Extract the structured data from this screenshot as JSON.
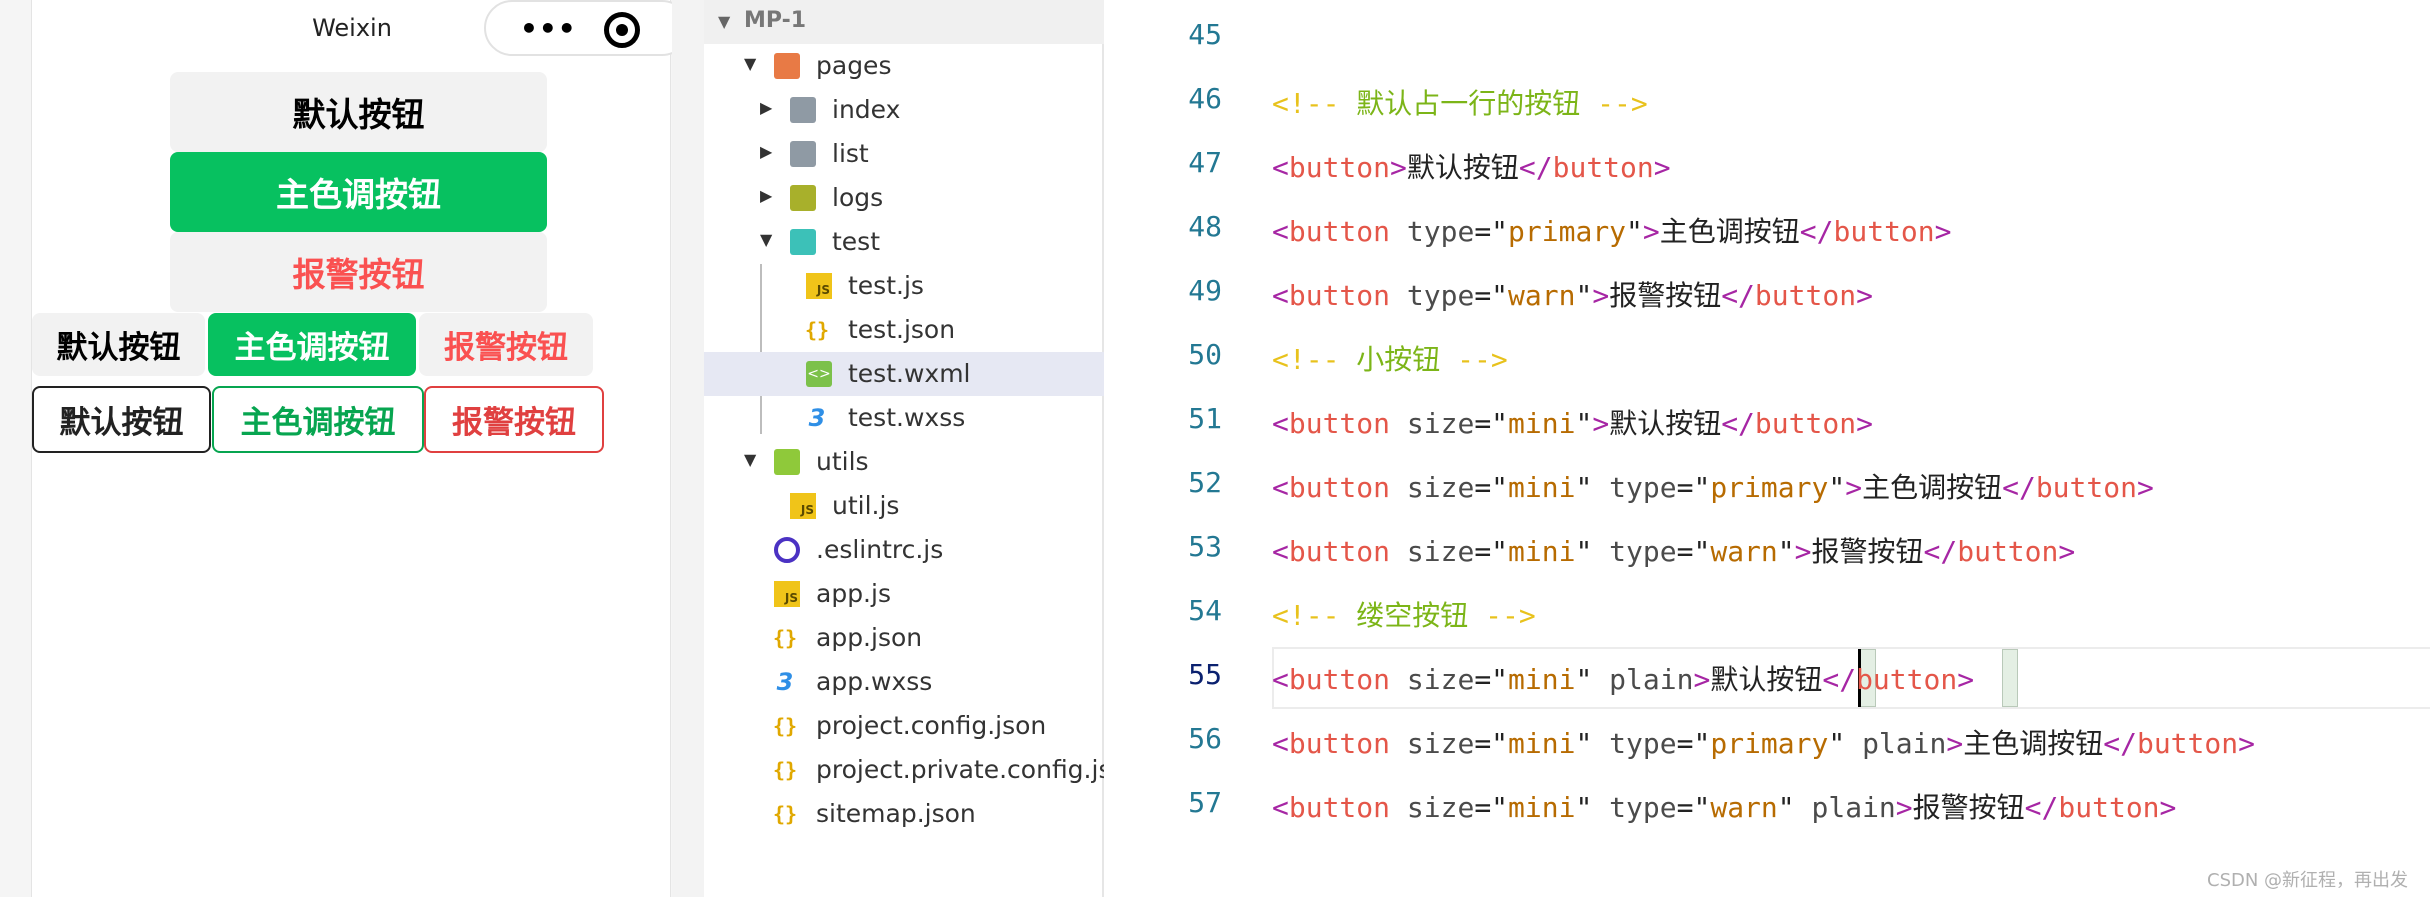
{
  "simulator": {
    "nav_title": "Weixin",
    "capsule": {
      "more_icon": "more-dots-icon",
      "close_icon": "target-icon"
    },
    "buttons_large": {
      "default": "默认按钮",
      "primary": "主色调按钮",
      "warn": "报警按钮"
    },
    "buttons_mini": {
      "default": "默认按钮",
      "primary": "主色调按钮",
      "warn": "报警按钮"
    },
    "buttons_plain": {
      "default": "默认按钮",
      "primary": "主色调按钮",
      "warn": "报警按钮"
    },
    "colors": {
      "primary": "#07c160",
      "warn": "#fa5151",
      "default_bg": "#f2f2f2"
    }
  },
  "file_tree": {
    "project": "MP-1",
    "items": [
      {
        "name": "pages",
        "icon": "folder-open-icon",
        "expanded": true
      },
      {
        "name": "index",
        "icon": "folder-icon",
        "expanded": false
      },
      {
        "name": "list",
        "icon": "folder-icon",
        "expanded": false
      },
      {
        "name": "logs",
        "icon": "folder-icon",
        "expanded": false
      },
      {
        "name": "test",
        "icon": "folder-open-icon",
        "expanded": true
      },
      {
        "name": "test.js",
        "icon": "js-file-icon"
      },
      {
        "name": "test.json",
        "icon": "json-file-icon"
      },
      {
        "name": "test.wxml",
        "icon": "wxml-file-icon",
        "selected": true
      },
      {
        "name": "test.wxss",
        "icon": "wxss-file-icon"
      },
      {
        "name": "utils",
        "icon": "folder-open-icon",
        "expanded": true
      },
      {
        "name": "util.js",
        "icon": "js-file-icon"
      },
      {
        "name": ".eslintrc.js",
        "icon": "eslint-file-icon"
      },
      {
        "name": "app.js",
        "icon": "js-file-icon"
      },
      {
        "name": "app.json",
        "icon": "json-file-icon"
      },
      {
        "name": "app.wxss",
        "icon": "wxss-file-icon"
      },
      {
        "name": "project.config.json",
        "icon": "json-file-icon"
      },
      {
        "name": "project.private.config.js...",
        "icon": "json-file-icon"
      },
      {
        "name": "sitemap.json",
        "icon": "json-file-icon"
      }
    ]
  },
  "editor": {
    "current_line": "55",
    "lines": [
      {
        "num": "45",
        "tokens": []
      },
      {
        "num": "46",
        "tokens": [
          {
            "t": "<!-- ",
            "c": "cmd"
          },
          {
            "t": "默认占一行的按钮",
            "c": "cm"
          },
          {
            "t": " -->",
            "c": "cmd"
          }
        ]
      },
      {
        "num": "47",
        "tokens": [
          {
            "t": "<",
            "c": "tg"
          },
          {
            "t": "button",
            "c": "tn"
          },
          {
            "t": ">",
            "c": "tg"
          },
          {
            "t": "默认按钮",
            "c": "txt"
          },
          {
            "t": "</",
            "c": "tg"
          },
          {
            "t": "button",
            "c": "tn"
          },
          {
            "t": ">",
            "c": "tg"
          }
        ]
      },
      {
        "num": "48",
        "tokens": [
          {
            "t": "<",
            "c": "tg"
          },
          {
            "t": "button",
            "c": "tn"
          },
          {
            "t": " type",
            "c": "an"
          },
          {
            "t": "=\"",
            "c": "txt"
          },
          {
            "t": "primary",
            "c": "av"
          },
          {
            "t": "\"",
            "c": "txt"
          },
          {
            "t": ">",
            "c": "tg"
          },
          {
            "t": "主色调按钮",
            "c": "txt"
          },
          {
            "t": "</",
            "c": "tg"
          },
          {
            "t": "button",
            "c": "tn"
          },
          {
            "t": ">",
            "c": "tg"
          }
        ]
      },
      {
        "num": "49",
        "tokens": [
          {
            "t": "<",
            "c": "tg"
          },
          {
            "t": "button",
            "c": "tn"
          },
          {
            "t": " type",
            "c": "an"
          },
          {
            "t": "=\"",
            "c": "txt"
          },
          {
            "t": "warn",
            "c": "av"
          },
          {
            "t": "\"",
            "c": "txt"
          },
          {
            "t": ">",
            "c": "tg"
          },
          {
            "t": "报警按钮",
            "c": "txt"
          },
          {
            "t": "</",
            "c": "tg"
          },
          {
            "t": "button",
            "c": "tn"
          },
          {
            "t": ">",
            "c": "tg"
          }
        ]
      },
      {
        "num": "50",
        "tokens": [
          {
            "t": "<!-- ",
            "c": "cmd"
          },
          {
            "t": "小按钮",
            "c": "cm"
          },
          {
            "t": " -->",
            "c": "cmd"
          }
        ]
      },
      {
        "num": "51",
        "tokens": [
          {
            "t": "<",
            "c": "tg"
          },
          {
            "t": "button",
            "c": "tn"
          },
          {
            "t": " size",
            "c": "an"
          },
          {
            "t": "=\"",
            "c": "txt"
          },
          {
            "t": "mini",
            "c": "av"
          },
          {
            "t": "\"",
            "c": "txt"
          },
          {
            "t": ">",
            "c": "tg"
          },
          {
            "t": "默认按钮",
            "c": "txt"
          },
          {
            "t": "</",
            "c": "tg"
          },
          {
            "t": "button",
            "c": "tn"
          },
          {
            "t": ">",
            "c": "tg"
          }
        ]
      },
      {
        "num": "52",
        "tokens": [
          {
            "t": "<",
            "c": "tg"
          },
          {
            "t": "button",
            "c": "tn"
          },
          {
            "t": " size",
            "c": "an"
          },
          {
            "t": "=\"",
            "c": "txt"
          },
          {
            "t": "mini",
            "c": "av"
          },
          {
            "t": "\"",
            "c": "txt"
          },
          {
            "t": " type",
            "c": "an"
          },
          {
            "t": "=\"",
            "c": "txt"
          },
          {
            "t": "primary",
            "c": "av"
          },
          {
            "t": "\"",
            "c": "txt"
          },
          {
            "t": ">",
            "c": "tg"
          },
          {
            "t": "主色调按钮",
            "c": "txt"
          },
          {
            "t": "</",
            "c": "tg"
          },
          {
            "t": "button",
            "c": "tn"
          },
          {
            "t": ">",
            "c": "tg"
          }
        ]
      },
      {
        "num": "53",
        "tokens": [
          {
            "t": "<",
            "c": "tg"
          },
          {
            "t": "button",
            "c": "tn"
          },
          {
            "t": " size",
            "c": "an"
          },
          {
            "t": "=\"",
            "c": "txt"
          },
          {
            "t": "mini",
            "c": "av"
          },
          {
            "t": "\"",
            "c": "txt"
          },
          {
            "t": " type",
            "c": "an"
          },
          {
            "t": "=\"",
            "c": "txt"
          },
          {
            "t": "warn",
            "c": "av"
          },
          {
            "t": "\"",
            "c": "txt"
          },
          {
            "t": ">",
            "c": "tg"
          },
          {
            "t": "报警按钮",
            "c": "txt"
          },
          {
            "t": "</",
            "c": "tg"
          },
          {
            "t": "button",
            "c": "tn"
          },
          {
            "t": ">",
            "c": "tg"
          }
        ]
      },
      {
        "num": "54",
        "tokens": [
          {
            "t": "<!-- ",
            "c": "cmd"
          },
          {
            "t": "缕空按钮",
            "c": "cm"
          },
          {
            "t": " -->",
            "c": "cmd"
          }
        ]
      },
      {
        "num": "55",
        "tokens": [
          {
            "t": "<",
            "c": "tg"
          },
          {
            "t": "button",
            "c": "tn"
          },
          {
            "t": " size",
            "c": "an"
          },
          {
            "t": "=\"",
            "c": "txt"
          },
          {
            "t": "mini",
            "c": "av"
          },
          {
            "t": "\"",
            "c": "txt"
          },
          {
            "t": " plain",
            "c": "an"
          },
          {
            "t": ">",
            "c": "tg"
          },
          {
            "t": "默认按钮",
            "c": "txt"
          },
          {
            "t": "</",
            "c": "tg"
          },
          {
            "t": "button",
            "c": "tn"
          },
          {
            "t": ">",
            "c": "tg"
          }
        ]
      },
      {
        "num": "56",
        "tokens": [
          {
            "t": "<",
            "c": "tg"
          },
          {
            "t": "button",
            "c": "tn"
          },
          {
            "t": " size",
            "c": "an"
          },
          {
            "t": "=\"",
            "c": "txt"
          },
          {
            "t": "mini",
            "c": "av"
          },
          {
            "t": "\"",
            "c": "txt"
          },
          {
            "t": " type",
            "c": "an"
          },
          {
            "t": "=\"",
            "c": "txt"
          },
          {
            "t": "primary",
            "c": "av"
          },
          {
            "t": "\"",
            "c": "txt"
          },
          {
            "t": " plain",
            "c": "an"
          },
          {
            "t": ">",
            "c": "tg"
          },
          {
            "t": "主色调按钮",
            "c": "txt"
          },
          {
            "t": "</",
            "c": "tg"
          },
          {
            "t": "button",
            "c": "tn"
          },
          {
            "t": ">",
            "c": "tg"
          }
        ]
      },
      {
        "num": "57",
        "tokens": [
          {
            "t": "<",
            "c": "tg"
          },
          {
            "t": "button",
            "c": "tn"
          },
          {
            "t": " size",
            "c": "an"
          },
          {
            "t": "=\"",
            "c": "txt"
          },
          {
            "t": "mini",
            "c": "av"
          },
          {
            "t": "\"",
            "c": "txt"
          },
          {
            "t": " type",
            "c": "an"
          },
          {
            "t": "=\"",
            "c": "txt"
          },
          {
            "t": "warn",
            "c": "av"
          },
          {
            "t": "\"",
            "c": "txt"
          },
          {
            "t": " plain",
            "c": "an"
          },
          {
            "t": ">",
            "c": "tg"
          },
          {
            "t": "报警按钮",
            "c": "txt"
          },
          {
            "t": "</",
            "c": "tg"
          },
          {
            "t": "button",
            "c": "tn"
          },
          {
            "t": ">",
            "c": "tg"
          }
        ]
      }
    ]
  },
  "watermark": "CSDN @新征程，再出发"
}
